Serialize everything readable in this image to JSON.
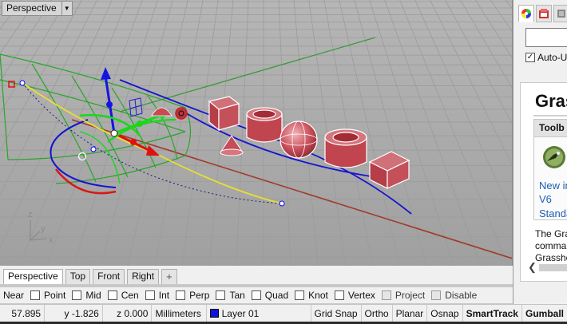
{
  "viewport": {
    "title": "Perspective",
    "dropdown_icon": "triangle-down",
    "axis_labels": {
      "z": "z",
      "y": "y",
      "x": "x"
    }
  },
  "panel": {
    "tabs": [
      "color-wheel-icon",
      "rhino-properties-icon",
      "layers-icon"
    ],
    "search_value": "",
    "auto_update_label": "Auto-U",
    "auto_update_checked": true,
    "help_title": "Gras",
    "toolbar_header": "Toolb",
    "toolbar_icon": "grasshopper-icon",
    "toolbar_link_new": "New in",
    "toolbar_link_v6": "V6",
    "toolbar_link_std": "Standa",
    "desc_lines": [
      "The Gra",
      "comma",
      "Grassho"
    ]
  },
  "view_tabs": {
    "tabs": [
      "Perspective",
      "Top",
      "Front",
      "Right"
    ],
    "active": "Perspective",
    "add_label": "+"
  },
  "osnap": {
    "label": "Near",
    "items": [
      {
        "label": "Point",
        "checked": false
      },
      {
        "label": "Mid",
        "checked": false
      },
      {
        "label": "Cen",
        "checked": false
      },
      {
        "label": "Int",
        "checked": false
      },
      {
        "label": "Perp",
        "checked": false
      },
      {
        "label": "Tan",
        "checked": false
      },
      {
        "label": "Quad",
        "checked": false
      },
      {
        "label": "Knot",
        "checked": false
      },
      {
        "label": "Vertex",
        "checked": false
      },
      {
        "label": "Project",
        "checked": false,
        "disabled": true
      },
      {
        "label": "Disable",
        "checked": false,
        "disabled": true
      }
    ]
  },
  "status": {
    "x": "57.895",
    "y": "y -1.826",
    "z": "z 0.000",
    "units": "Millimeters",
    "layer": "Layer 01",
    "layer_color": "#1010e0",
    "toggles": [
      "Grid Snap",
      "Ortho",
      "Planar",
      "Osnap"
    ],
    "smarttrack": "SmartTrack",
    "gumball": "Gumball"
  }
}
